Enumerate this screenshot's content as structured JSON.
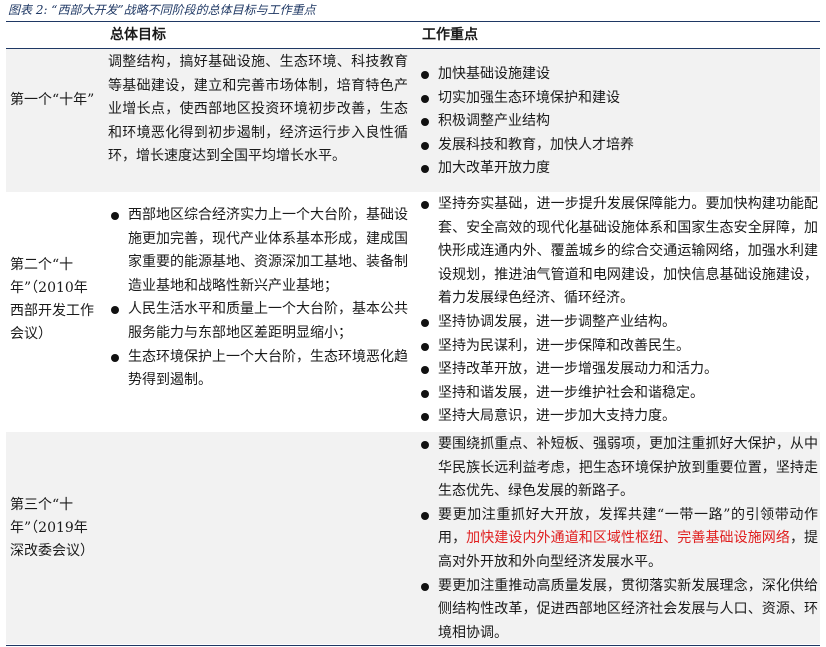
{
  "caption": "图表 2: “西部大开发”战略不同阶段的总体目标与工作重点",
  "headers": {
    "goal": "总体目标",
    "focus": "工作重点"
  },
  "rows": [
    {
      "label": "第一个“十年”",
      "goal": "调整结构，搞好基础设施、生态环境、科技教育等基础建设，建立和完善市场体制，培育特色产业增长点，使西部地区投资环境初步改善，生态和环境恶化得到初步遏制，经济运行步入良性循环，增长速度达到全国平均增长水平。",
      "focus": [
        "加快基础设施建设",
        "切实加强生态环境保护和建设",
        "积极调整产业结构",
        "发展科技和教育，加快人才培养",
        "加大改革开放力度"
      ]
    },
    {
      "label": "第二个“十年”（2010年西部开发工作会议）",
      "goal": [
        "西部地区综合经济实力上一个大台阶，基础设施更加完善，现代产业体系基本形成，建成国家重要的能源基地、资源深加工基地、装备制造业基地和战略性新兴产业基地；",
        "人民生活水平和质量上一个大台阶，基本公共服务能力与东部地区差距明显缩小；",
        "生态环境保护上一个大台阶，生态环境恶化趋势得到遏制。"
      ],
      "focus": [
        "坚持夯实基础，进一步提升发展保障能力。要加快构建功能配套、安全高效的现代化基础设施体系和国家生态安全屏障，加快形成连通内外、覆盖城乡的综合交通运输网络，加强水利建设规划，推进油气管道和电网建设，加快信息基础设施建设，着力发展绿色经济、循环经济。",
        "坚持协调发展，进一步调整产业结构。",
        "坚持为民谋利，进一步保障和改善民生。",
        "坚持改革开放，进一步增强发展动力和活力。",
        "坚持和谐发展，进一步维护社会和谐稳定。",
        "坚持大局意识，进一步加大支持力度。"
      ]
    },
    {
      "label": "第三个“十年”（2019年深改委会议）",
      "focus": [
        {
          "text": "要围绕抓重点、补短板、强弱项，更加注重抓好大保护，从中华民族长远利益考虑，把生态环境保护放到重要位置，坚持走生态优先、绿色发展的新路子。"
        },
        {
          "pre": "要更加注重抓好大开放，发挥共建“一带一路”的引领带动作用，",
          "highlight": "加快建设内外通道和区域性枢纽、完善基础设施网络",
          "post": "，提高对外开放和外向型经济发展水平。"
        },
        {
          "text": "要更加注重推动高质量发展，贯彻落实新发展理念，深化供给侧结构性改革，促进西部地区经济社会发展与人口、资源、环境相协调。"
        }
      ]
    }
  ],
  "colors": {
    "caption": "#1f3864",
    "highlight": "#e02020",
    "shade": "#f2f2f2"
  }
}
